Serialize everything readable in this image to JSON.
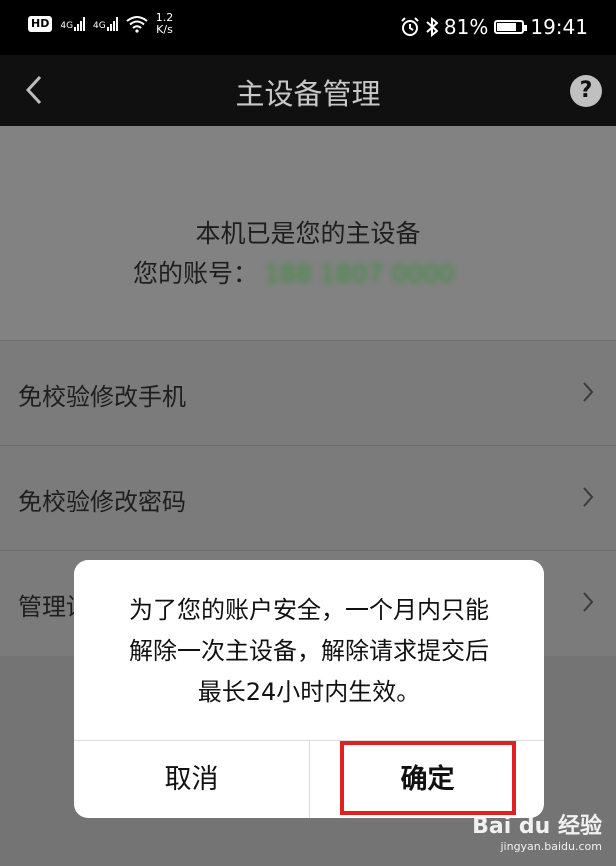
{
  "status_bar": {
    "hd": "HD",
    "network1": "4G",
    "network2": "4G",
    "speed_value": "1.2",
    "speed_unit": "K/s",
    "battery_percent": "81%",
    "battery_level": 0.81,
    "time": "19:41"
  },
  "nav": {
    "title": "主设备管理",
    "help": "?"
  },
  "account_block": {
    "device_text": "本机已是您的主设备",
    "account_label": "您的账号：",
    "account_value": "188 1807 0000"
  },
  "list": {
    "items": [
      {
        "label": "免校验修改手机"
      },
      {
        "label": "免校验修改密码"
      },
      {
        "label": "管理设"
      }
    ]
  },
  "dialog": {
    "line1": "为了您的账户安全，一个月内只能",
    "line2": "解除一次主设备，解除请求提交后",
    "line3": "最长24小时内生效。",
    "cancel_label": "取消",
    "confirm_label": "确定"
  },
  "watermark": {
    "logo": "Bai du 经验",
    "url": "jingyan.baidu.com"
  },
  "colors": {
    "highlight": "#e0211f",
    "overlay": "#7b7b7b"
  }
}
